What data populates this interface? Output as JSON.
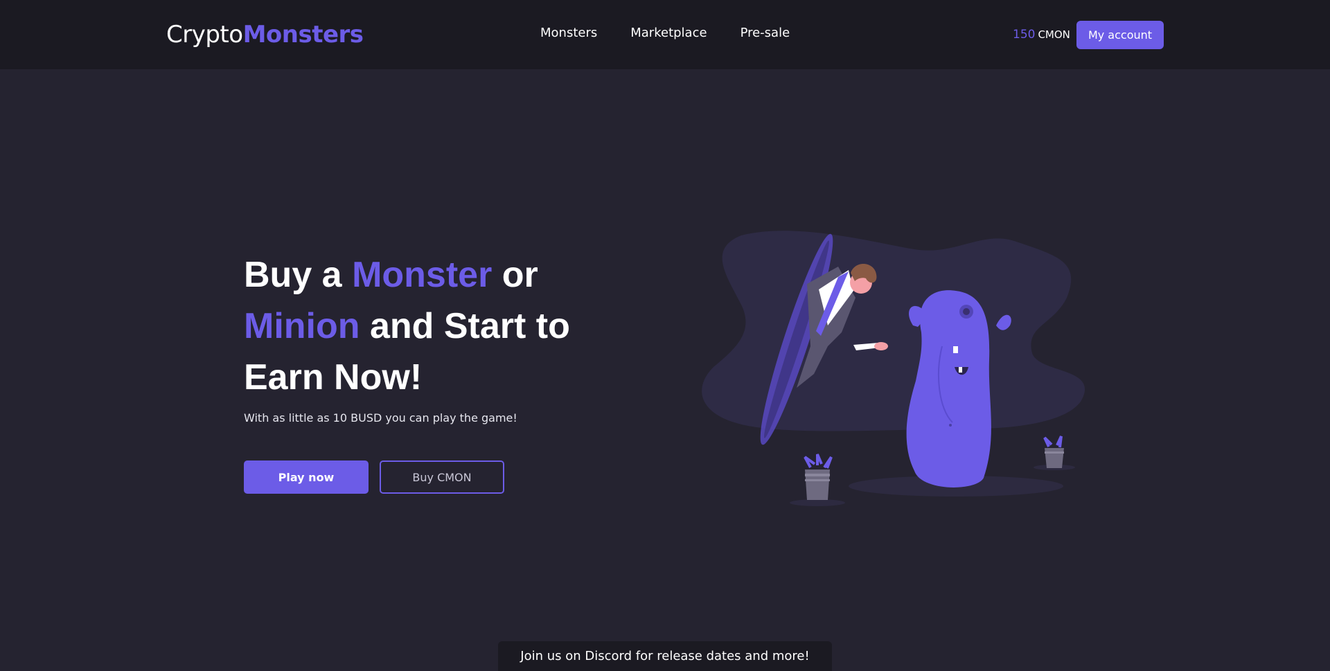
{
  "brand": {
    "name_light": "Crypto",
    "name_bold": "Monsters"
  },
  "nav": {
    "items": [
      {
        "label": "Monsters"
      },
      {
        "label": "Marketplace"
      },
      {
        "label": "Pre-sale"
      }
    ]
  },
  "wallet": {
    "amount": "150",
    "unit": "CMON",
    "account_label": "My account"
  },
  "hero": {
    "title_part1": "Buy a ",
    "title_accent1": "Monster",
    "title_part2": " or",
    "title_accent2": "Minion",
    "title_part3": " and Start to Earn Now!",
    "subtitle": "With as little as 10 BUSD you can play the game!",
    "primary_button": "Play now",
    "secondary_button": "Buy CMON"
  },
  "illustration": {
    "icon": "portal-monster-illustration"
  },
  "discord": {
    "text": "Join us on Discord for release dates and more!"
  },
  "colors": {
    "accent": "#6c5ce7",
    "background": "#252330",
    "navbar": "#1b1a22"
  }
}
